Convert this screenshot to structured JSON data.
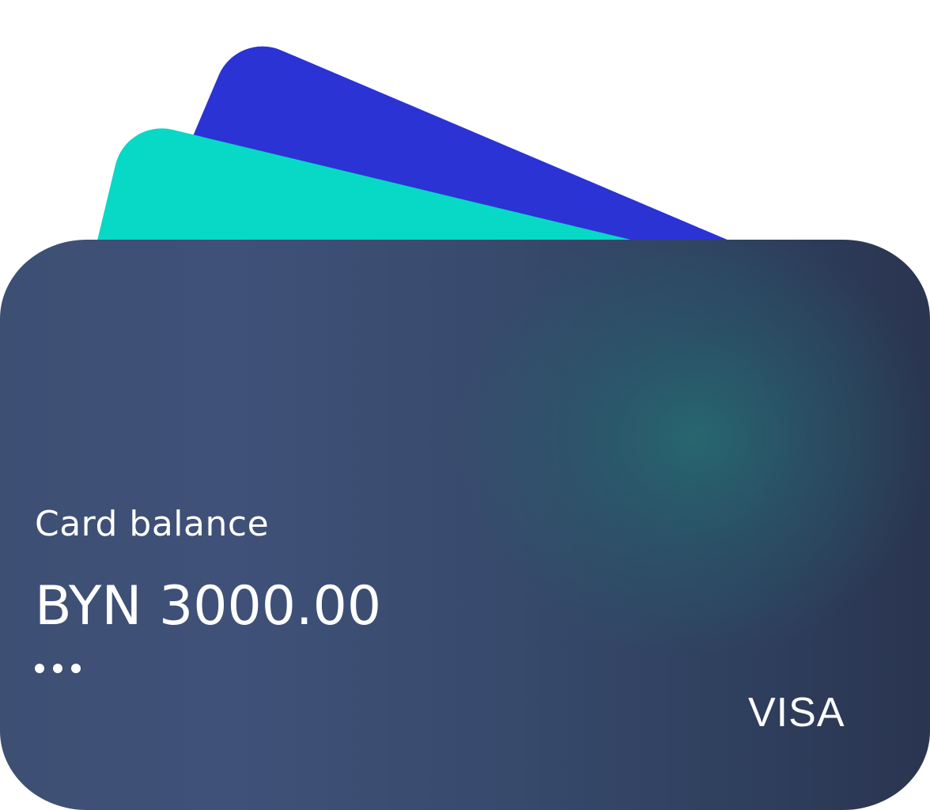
{
  "cards": {
    "back_cards": [
      {
        "color": "#2b33d4"
      },
      {
        "color": "#08d8c6"
      }
    ],
    "main_card": {
      "gradient_colors": [
        "#3d4f73",
        "#2a3550",
        "#266870"
      ],
      "balance_label": "Card balance",
      "balance_amount": "BYN 3000.00",
      "more_icon": "more-dots-icon",
      "brand": "VISA"
    }
  }
}
